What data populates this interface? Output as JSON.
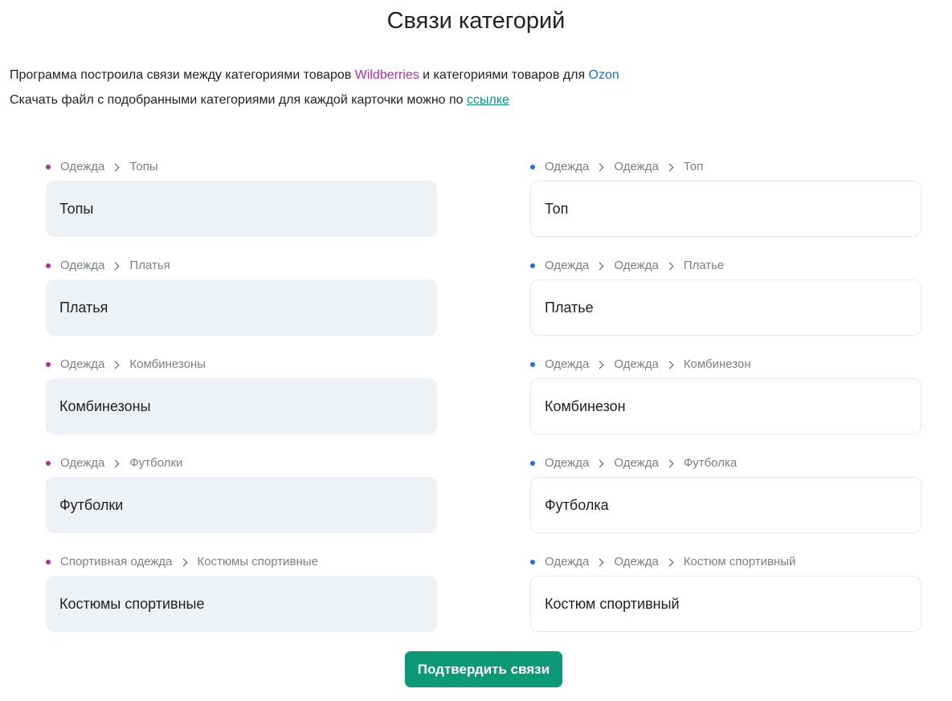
{
  "header": {
    "title": "Связи категорий"
  },
  "intro": {
    "line1_before": "Программа построила связи между категориями товаров ",
    "wb_name": "Wildberries",
    "line1_middle": " и категориями товаров для ",
    "ozon_name": "Ozon",
    "line2_before": "Скачать файл с подобранными категориями для каждой карточки можно по ",
    "link_text": "ссылке"
  },
  "colors": {
    "wildberries": "#b02ea4",
    "ozon": "#1f6fe0",
    "accent": "#0c9a76"
  },
  "rows": [
    {
      "wb_path": [
        "Одежда",
        "Топы"
      ],
      "wb_value": "Топы",
      "ozon_path": [
        "Одежда",
        "Одежда",
        "Топ"
      ],
      "ozon_value": "Топ"
    },
    {
      "wb_path": [
        "Одежда",
        "Платья"
      ],
      "wb_value": "Платья",
      "ozon_path": [
        "Одежда",
        "Одежда",
        "Платье"
      ],
      "ozon_value": "Платье"
    },
    {
      "wb_path": [
        "Одежда",
        "Комбинезоны"
      ],
      "wb_value": "Комбинезоны",
      "ozon_path": [
        "Одежда",
        "Одежда",
        "Комбинезон"
      ],
      "ozon_value": "Комбинезон"
    },
    {
      "wb_path": [
        "Одежда",
        "Футболки"
      ],
      "wb_value": "Футболки",
      "ozon_path": [
        "Одежда",
        "Одежда",
        "Футболка"
      ],
      "ozon_value": "Футболка"
    },
    {
      "wb_path": [
        "Спортивная одежда",
        "Костюмы спортивные"
      ],
      "wb_value": "Костюмы спортивные",
      "ozon_path": [
        "Одежда",
        "Одежда",
        "Костюм спортивный"
      ],
      "ozon_value": "Костюм спортивный"
    }
  ],
  "actions": {
    "confirm_label": "Подтвердить связи"
  }
}
